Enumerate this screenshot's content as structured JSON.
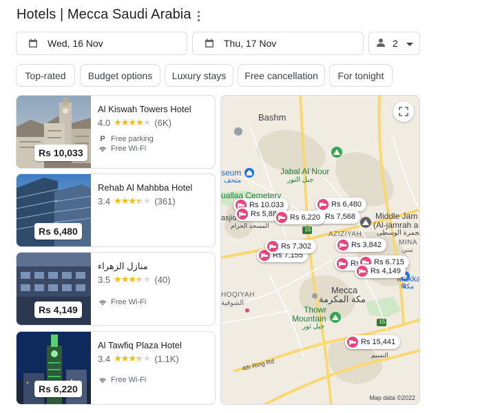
{
  "header": {
    "title": "Hotels | Mecca Saudi Arabia"
  },
  "search": {
    "checkin": "Wed, 16 Nov",
    "checkout": "Thu, 17 Nov",
    "guests": "2"
  },
  "filters": [
    "Top-rated",
    "Budget options",
    "Luxury stays",
    "Free cancellation",
    "For tonight"
  ],
  "hotels": [
    {
      "name": "Al Kiswah Towers Hotel",
      "rating": "4.0",
      "stars": 4.0,
      "reviews": "(6K)",
      "price": "Rs 10,033",
      "features": [
        "Free parking",
        "Free Wi-Fi"
      ]
    },
    {
      "name": "Rehab Al Mahbba Hotel",
      "rating": "3.4",
      "stars": 3.4,
      "reviews": "(361)",
      "price": "Rs 6,480",
      "features": []
    },
    {
      "name": "منازل الزهراء",
      "rating": "3.5",
      "stars": 3.5,
      "reviews": "(40)",
      "price": "Rs 4,149",
      "features": [
        "Free Wi-Fi"
      ]
    },
    {
      "name": "Al Tawfiq Plaza Hotel",
      "rating": "3.4",
      "stars": 3.4,
      "reviews": "(1.1K)",
      "price": "Rs 6,220",
      "features": [
        "Free Wi-Fi"
      ]
    }
  ],
  "map": {
    "labels": {
      "bashm": "Bashm",
      "jabal_en": "Jabal Al Nour",
      "jabal_ar": "جبل النور",
      "museum_en": "seum",
      "museum_ar": "متحف",
      "cemetery": "uallaa Cemetery",
      "masjid": "asjid",
      "masjid_ar": "المسجد الحرام",
      "middle_jam": "Middle Jam",
      "jamrah": "(Al-jamrah a",
      "jamrah_ar": "الجمرة الوسطى",
      "aziziyah": "AZIZIYAH",
      "mina": "MINA",
      "mina_ar": "منى",
      "hoqiyah": "HOQIYAH",
      "hoqiyah_ar": "الشوقية",
      "mecca_en": "Mecca",
      "mecca_ar": "مكة المكرمة",
      "thowr": "Thowr",
      "mountain": "Mountain",
      "thowr_ar": "جبل ثور",
      "makka": "Makka",
      "makka_ar": "مكة",
      "ring_rd": "4th Ring Rd",
      "nasim_ar": "النسيم",
      "r15": "15",
      "copyright": "Map data ©2022"
    },
    "pins": [
      "Rs 10,033",
      "Rs 6,480",
      "Rs 5,88",
      "Rs 6,220",
      "Rs 7,568",
      "Rs 3,842",
      "Rs 7,302",
      "Rs 7,155",
      "Rs",
      "Rs 6,715",
      "Rs 4,149",
      "Rs 15,441"
    ]
  },
  "colors": {
    "star": "#fbbc04",
    "pin": "#e8457a",
    "park": "#188038",
    "road": "#f9d870"
  }
}
